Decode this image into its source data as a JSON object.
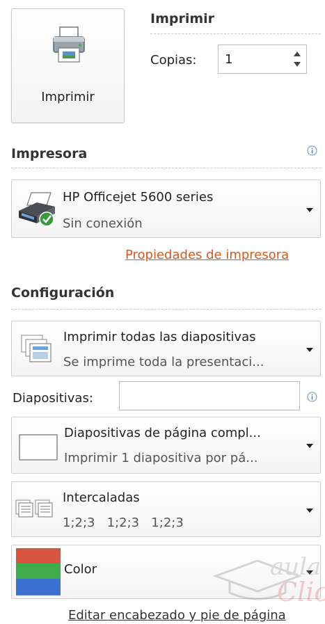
{
  "print": {
    "button_label": "Imprimir",
    "section_title": "Imprimir",
    "copies_label": "Copias:",
    "copies_value": "1"
  },
  "printer": {
    "section_title": "Impresora",
    "name": "HP Officejet 5600 series",
    "status": "Sin conexión",
    "properties_link": "Propiedades de impresora"
  },
  "settings": {
    "section_title": "Configuración",
    "range": {
      "main": "Imprimir todas las diapositivas",
      "sub": "Se imprime toda la presentaci..."
    },
    "slides_label": "Diapositivas:",
    "slides_value": "",
    "layout": {
      "main": "Diapositivas de página compl...",
      "sub": "Imprimir 1 diapositiva por pá..."
    },
    "collation": {
      "main": "Intercaladas",
      "sub": "1;2;3   1;2;3   1;2;3"
    },
    "color": {
      "main": "Color"
    },
    "header_footer_link": "Editar encabezado y pie de página"
  },
  "colors": {
    "link": "#d25a1c",
    "status_ok": "#3a9a3a"
  },
  "watermark_text": "aula Clic"
}
